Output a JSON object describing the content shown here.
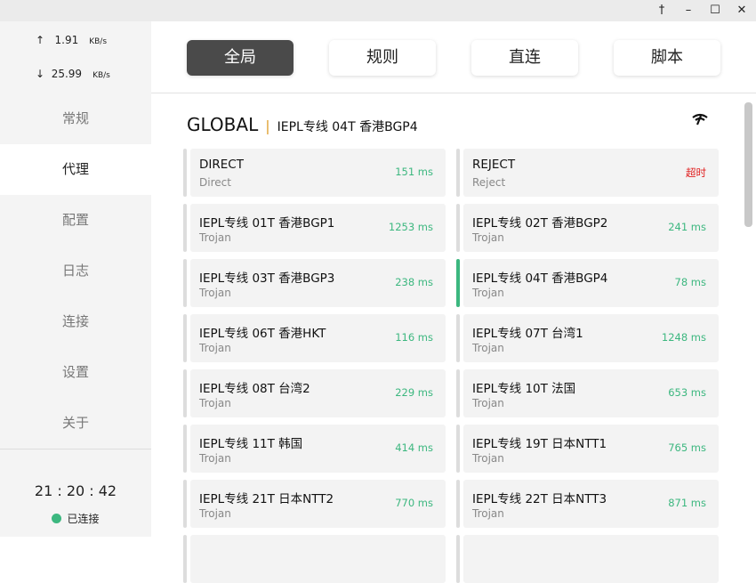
{
  "window": {
    "pin": "📌",
    "min": "–",
    "max": "☐",
    "close": "✕"
  },
  "traffic": {
    "up_arrow": "↑",
    "up": "1.91",
    "up_unit": "KB/s",
    "down_arrow": "↓",
    "down": "25.99",
    "down_unit": "KB/s"
  },
  "nav": [
    {
      "label": "常规"
    },
    {
      "label": "代理"
    },
    {
      "label": "配置"
    },
    {
      "label": "日志"
    },
    {
      "label": "连接"
    },
    {
      "label": "设置"
    },
    {
      "label": "关于"
    }
  ],
  "clock": "21 : 20 : 42",
  "status": "已连接",
  "modes": [
    {
      "label": "全局"
    },
    {
      "label": "规则"
    },
    {
      "label": "直连"
    },
    {
      "label": "脚本"
    }
  ],
  "group": {
    "name": "GLOBAL",
    "separator": "|",
    "selected": "IEPL专线 04T 香港BGP4"
  },
  "proxies": [
    {
      "name": "DIRECT",
      "type": "Direct",
      "delay": "151 ms"
    },
    {
      "name": "REJECT",
      "type": "Reject",
      "delay": "超时"
    },
    {
      "name": "IEPL专线 01T 香港BGP1",
      "type": "Trojan",
      "delay": "1253 ms"
    },
    {
      "name": "IEPL专线 02T 香港BGP2",
      "type": "Trojan",
      "delay": "241 ms"
    },
    {
      "name": "IEPL专线 03T 香港BGP3",
      "type": "Trojan",
      "delay": "238 ms"
    },
    {
      "name": "IEPL专线 04T 香港BGP4",
      "type": "Trojan",
      "delay": "78 ms"
    },
    {
      "name": "IEPL专线 06T 香港HKT",
      "type": "Trojan",
      "delay": "116 ms"
    },
    {
      "name": "IEPL专线 07T 台湾1",
      "type": "Trojan",
      "delay": "1248 ms"
    },
    {
      "name": "IEPL专线 08T 台湾2",
      "type": "Trojan",
      "delay": "229 ms"
    },
    {
      "name": "IEPL专线 10T 法国",
      "type": "Trojan",
      "delay": "653 ms"
    },
    {
      "name": "IEPL专线 11T 韩国",
      "type": "Trojan",
      "delay": "414 ms"
    },
    {
      "name": "IEPL专线 19T 日本NTT1",
      "type": "Trojan",
      "delay": "765 ms"
    },
    {
      "name": "IEPL专线 21T 日本NTT2",
      "type": "Trojan",
      "delay": "770 ms"
    },
    {
      "name": "IEPL专线 22T 日本NTT3",
      "type": "Trojan",
      "delay": "871 ms"
    }
  ],
  "colors": {
    "accent": "#3cb77f",
    "timeout": "#e02020",
    "active_mode": "#4a4a4a"
  }
}
